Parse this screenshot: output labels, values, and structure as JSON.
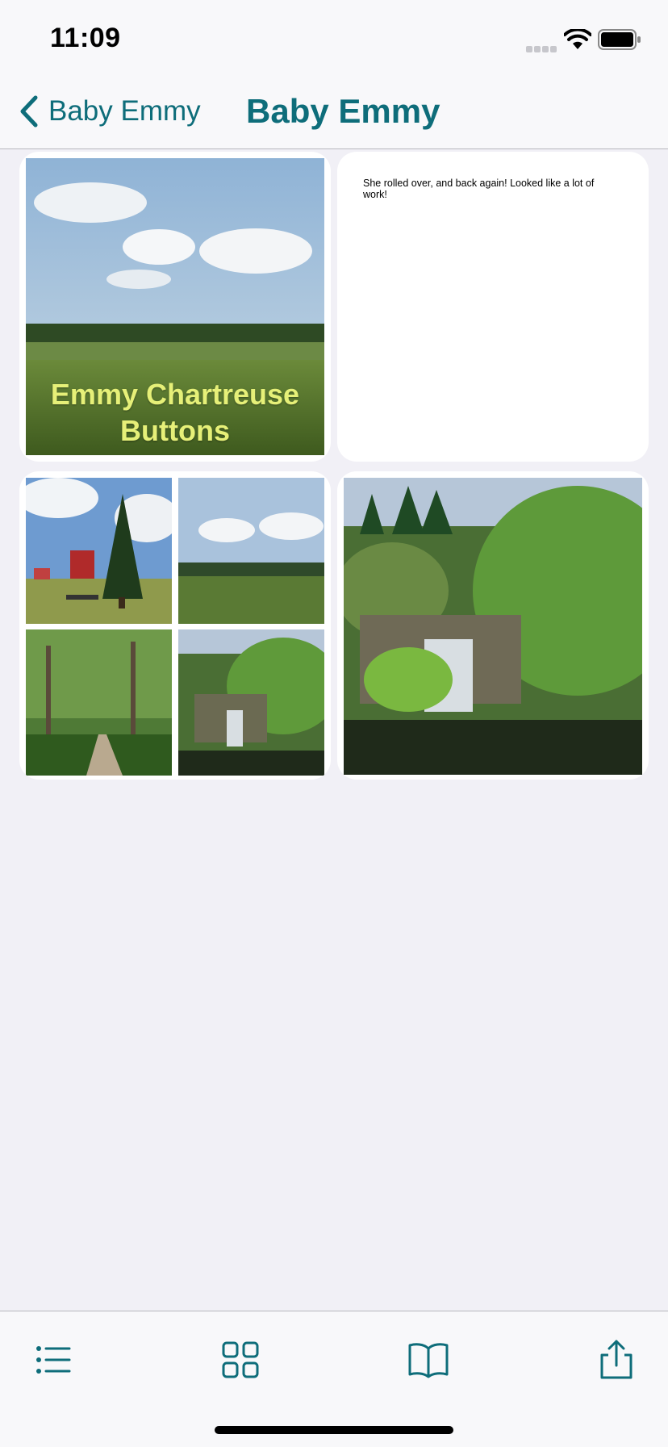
{
  "status_bar": {
    "time": "11:09"
  },
  "nav": {
    "back_label": "Baby Emmy",
    "title": "Baby Emmy"
  },
  "cards": {
    "cover_caption": "Emmy Chartreuse Buttons",
    "note_text": "She rolled over, and back again! Looked like a lot of work!"
  },
  "toolbar": {
    "icons": [
      "list-icon",
      "grid-icon",
      "book-icon",
      "share-icon"
    ]
  },
  "colors": {
    "accent": "#0e6d7a",
    "background": "#f1f0f6",
    "caption": "#e6f078"
  }
}
